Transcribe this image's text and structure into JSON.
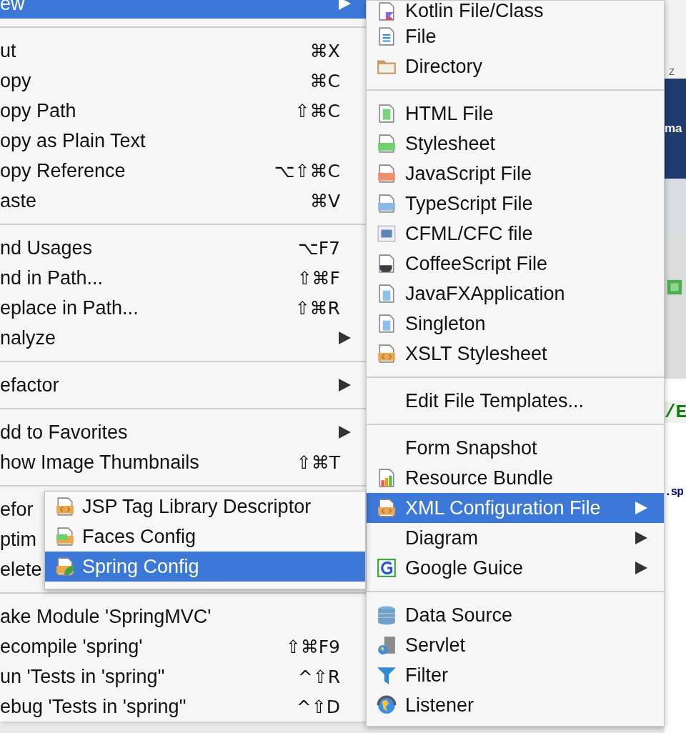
{
  "context_menu": {
    "items": [
      {
        "kind": "item",
        "label": "ew",
        "submenu": true,
        "selected": true
      },
      {
        "kind": "separator"
      },
      {
        "kind": "item",
        "label": "ut",
        "shortcut": "⌘X",
        "selected": false
      },
      {
        "kind": "item",
        "label": "opy",
        "shortcut": "⌘C",
        "selected": false
      },
      {
        "kind": "item",
        "label": "opy Path",
        "shortcut": "⇧⌘C",
        "selected": false
      },
      {
        "kind": "item",
        "label": "opy as Plain Text",
        "selected": false
      },
      {
        "kind": "item",
        "label": "opy Reference",
        "shortcut": "⌥⇧⌘C",
        "selected": false
      },
      {
        "kind": "item",
        "label": "aste",
        "shortcut": "⌘V",
        "selected": false
      },
      {
        "kind": "separator"
      },
      {
        "kind": "item",
        "label": "nd Usages",
        "shortcut": "⌥F7",
        "selected": false
      },
      {
        "kind": "item",
        "label": "nd in Path...",
        "shortcut": "⇧⌘F",
        "selected": false
      },
      {
        "kind": "item",
        "label": "eplace in Path...",
        "shortcut": "⇧⌘R",
        "selected": false
      },
      {
        "kind": "item",
        "label": "nalyze",
        "submenu": true,
        "selected": false
      },
      {
        "kind": "separator"
      },
      {
        "kind": "item",
        "label": "efactor",
        "submenu": true,
        "selected": false
      },
      {
        "kind": "separator"
      },
      {
        "kind": "item",
        "label": "dd to Favorites",
        "submenu": true,
        "selected": false
      },
      {
        "kind": "item",
        "label": "how Image Thumbnails",
        "shortcut": "⇧⌘T",
        "selected": false
      },
      {
        "kind": "separator"
      },
      {
        "kind": "item",
        "label": "efor",
        "selected": false
      },
      {
        "kind": "item",
        "label": "ptim",
        "selected": false
      },
      {
        "kind": "item",
        "label": "elete",
        "selected": false
      },
      {
        "kind": "separator"
      },
      {
        "kind": "item",
        "label": "ake Module 'SpringMVC'",
        "selected": false
      },
      {
        "kind": "item",
        "label": "ecompile 'spring'",
        "shortcut": "⇧⌘F9",
        "selected": false
      },
      {
        "kind": "item",
        "label": "un 'Tests in 'spring''",
        "shortcut": "^⇧R",
        "selected": false
      },
      {
        "kind": "item",
        "label": "ebug 'Tests in 'spring''",
        "shortcut": "^⇧D",
        "selected": false
      }
    ]
  },
  "new_submenu": {
    "items": [
      {
        "kind": "kotlin",
        "label": "Kotlin File/Class",
        "selected": false
      },
      {
        "kind": "file",
        "label": "File",
        "selected": false
      },
      {
        "kind": "folder",
        "label": "Directory",
        "selected": false
      },
      {
        "kind": "separator"
      },
      {
        "kind": "html",
        "label": "HTML File",
        "selected": false
      },
      {
        "kind": "css",
        "label": "Stylesheet",
        "selected": false
      },
      {
        "kind": "js",
        "label": "JavaScript File",
        "selected": false
      },
      {
        "kind": "ts",
        "label": "TypeScript File",
        "selected": false
      },
      {
        "kind": "cf",
        "label": "CFML/CFC file",
        "selected": false
      },
      {
        "kind": "coffee",
        "label": "CoffeeScript File",
        "selected": false
      },
      {
        "kind": "java",
        "label": "JavaFXApplication",
        "selected": false
      },
      {
        "kind": "java",
        "label": "Singleton",
        "selected": false
      },
      {
        "kind": "xml",
        "label": "XSLT Stylesheet",
        "selected": false
      },
      {
        "kind": "separator"
      },
      {
        "kind": "plain",
        "label": "Edit File Templates...",
        "selected": false
      },
      {
        "kind": "separator"
      },
      {
        "kind": "plain",
        "label": "Form Snapshot",
        "selected": false
      },
      {
        "kind": "bundle",
        "label": "Resource Bundle",
        "selected": false
      },
      {
        "kind": "xml",
        "label": "XML Configuration File",
        "submenu": true,
        "selected": true
      },
      {
        "kind": "plain",
        "label": "Diagram",
        "submenu": true,
        "selected": false
      },
      {
        "kind": "guice",
        "label": "Google Guice",
        "submenu": true,
        "selected": false
      },
      {
        "kind": "separator"
      },
      {
        "kind": "database",
        "label": "Data Source",
        "selected": false
      },
      {
        "kind": "server",
        "label": "Servlet",
        "selected": false
      },
      {
        "kind": "filter",
        "label": "Filter",
        "selected": false
      },
      {
        "kind": "globe",
        "label": "Listener",
        "selected": false
      }
    ]
  },
  "xml_submenu": {
    "items": [
      {
        "kind": "xml",
        "label": "JSP Tag Library Descriptor",
        "selected": false
      },
      {
        "kind": "jsf",
        "label": "Faces Config",
        "selected": false
      },
      {
        "kind": "spring",
        "label": "Spring Config",
        "selected": true
      }
    ]
  },
  "background": {
    "wallpaper_text": "ma",
    "corner_text": "Z",
    "code_fragments": [
      {
        "text": "/E",
        "kind": "string"
      },
      {
        "text": ".sp",
        "kind": "tag"
      }
    ]
  }
}
